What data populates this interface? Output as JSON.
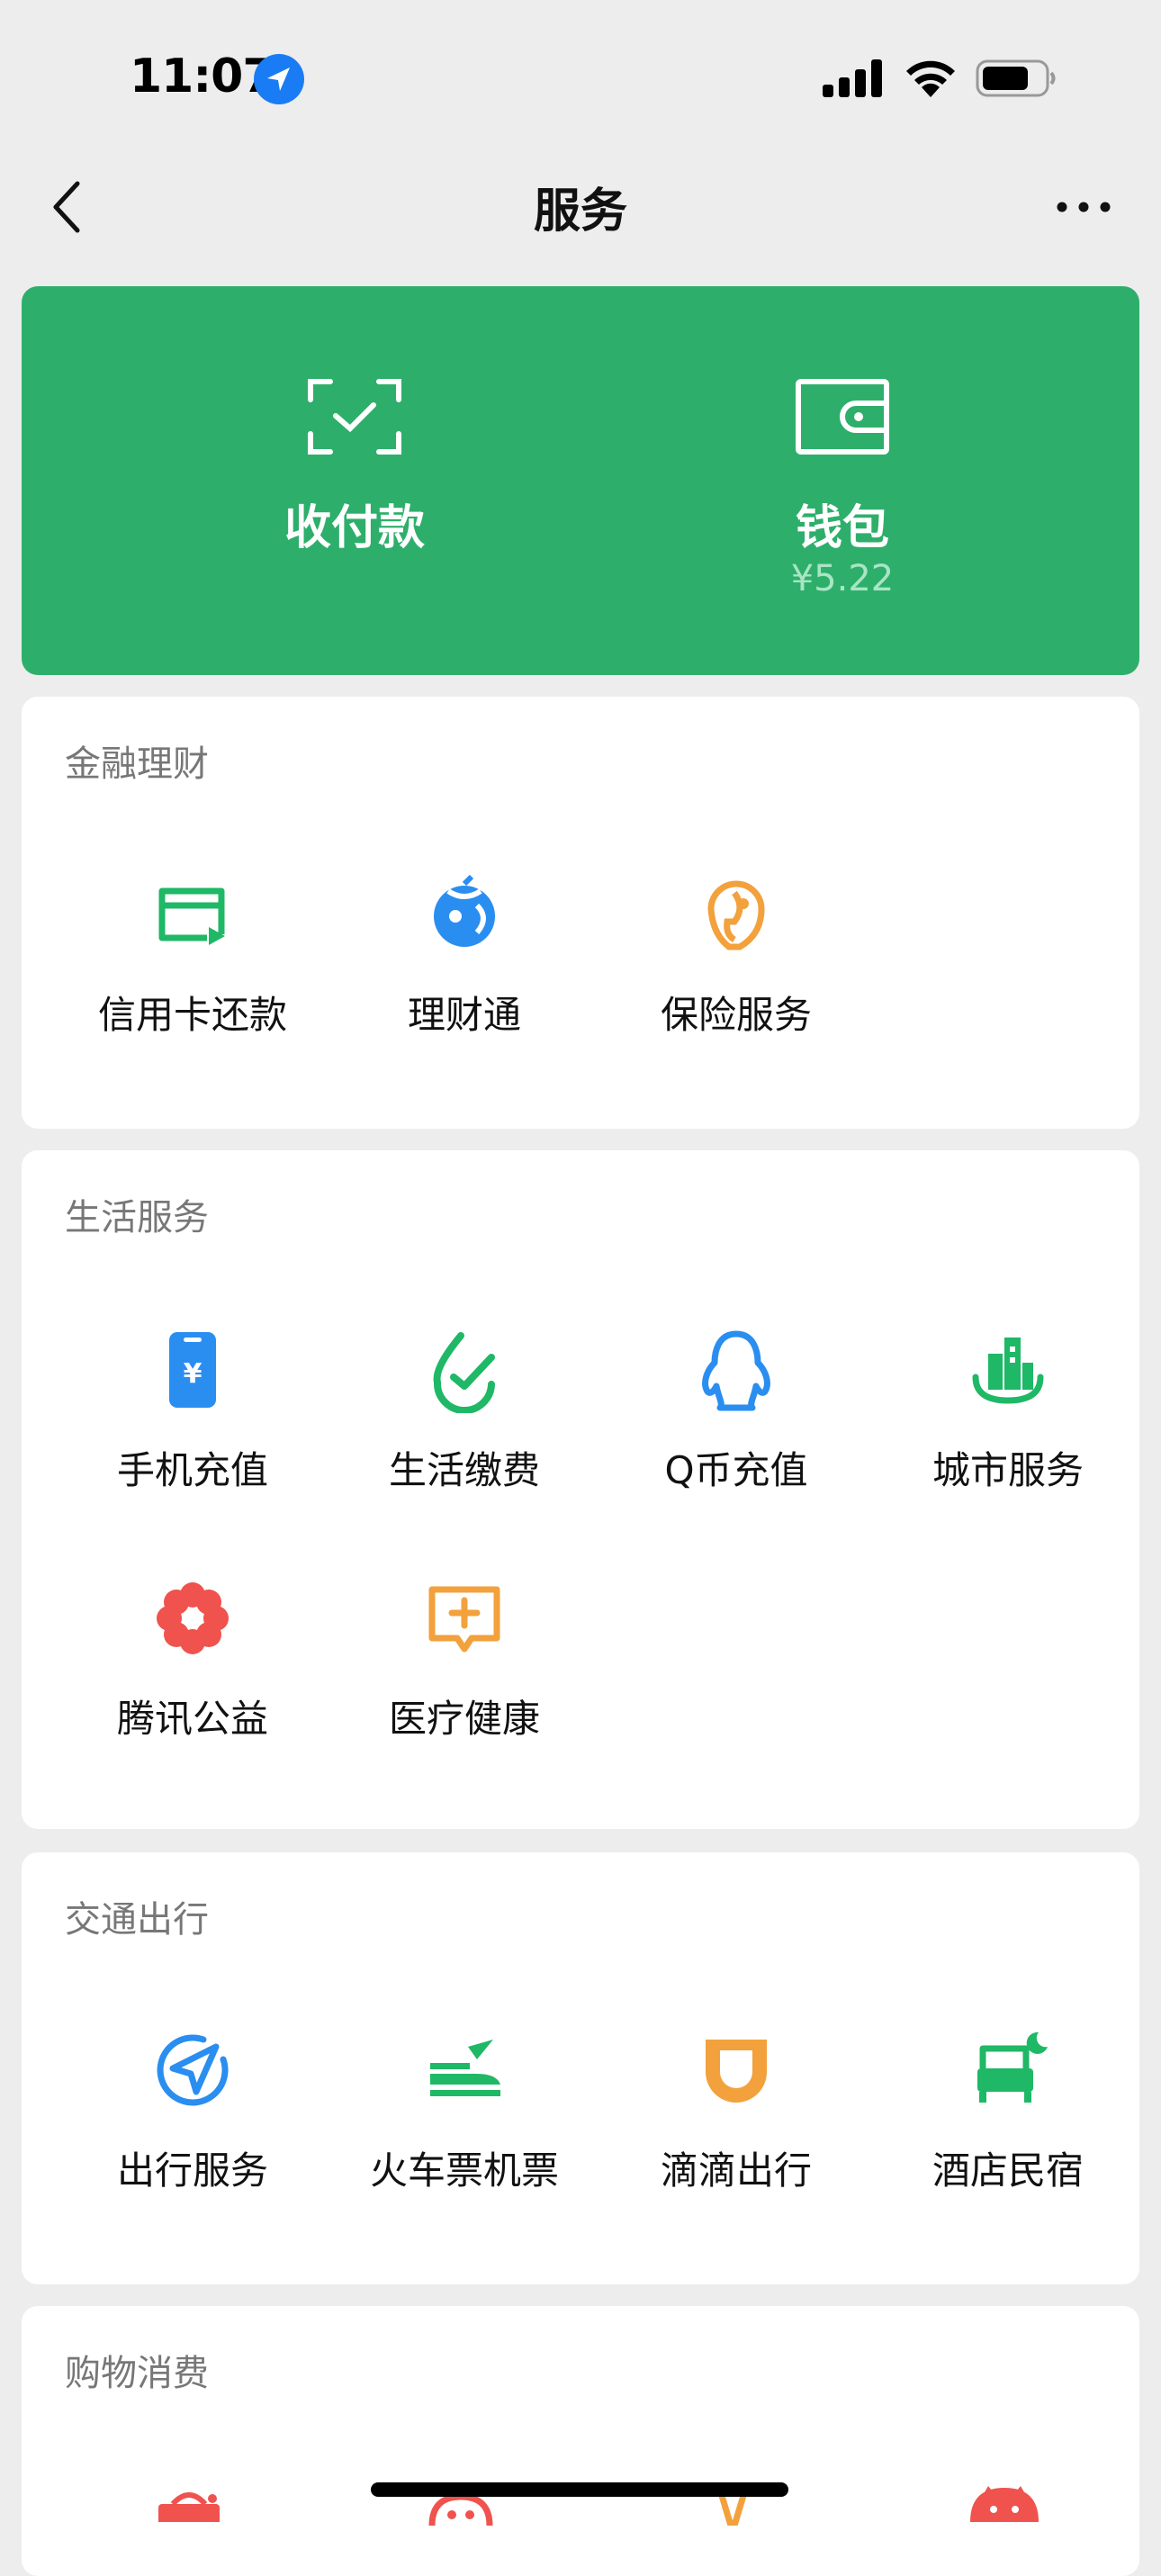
{
  "status_bar": {
    "time": "11:07"
  },
  "nav": {
    "title": "服务"
  },
  "wallet_card": {
    "pay_label": "收付款",
    "wallet_label": "钱包",
    "wallet_balance": "¥5.22"
  },
  "sections": [
    {
      "title": "金融理财",
      "items": [
        {
          "label": "信用卡还款",
          "icon": "credit-card-icon"
        },
        {
          "label": "理财通",
          "icon": "wealth-icon"
        },
        {
          "label": "保险服务",
          "icon": "insurance-icon"
        }
      ]
    },
    {
      "title": "生活服务",
      "items": [
        {
          "label": "手机充值",
          "icon": "phone-topup-icon"
        },
        {
          "label": "生活缴费",
          "icon": "utility-payment-icon"
        },
        {
          "label": "Q币充值",
          "icon": "qq-coin-icon"
        },
        {
          "label": "城市服务",
          "icon": "city-services-icon"
        },
        {
          "label": "腾讯公益",
          "icon": "charity-icon"
        },
        {
          "label": "医疗健康",
          "icon": "medical-icon"
        }
      ]
    },
    {
      "title": "交通出行",
      "items": [
        {
          "label": "出行服务",
          "icon": "travel-services-icon"
        },
        {
          "label": "火车票机票",
          "icon": "train-plane-icon"
        },
        {
          "label": "滴滴出行",
          "icon": "didi-icon"
        },
        {
          "label": "酒店民宿",
          "icon": "hotel-icon"
        }
      ]
    },
    {
      "title": "购物消费",
      "items": []
    }
  ],
  "colors": {
    "green": "#2daf6b",
    "blue": "#2a8ef0",
    "orange": "#f2a13c",
    "red": "#f0524d"
  }
}
